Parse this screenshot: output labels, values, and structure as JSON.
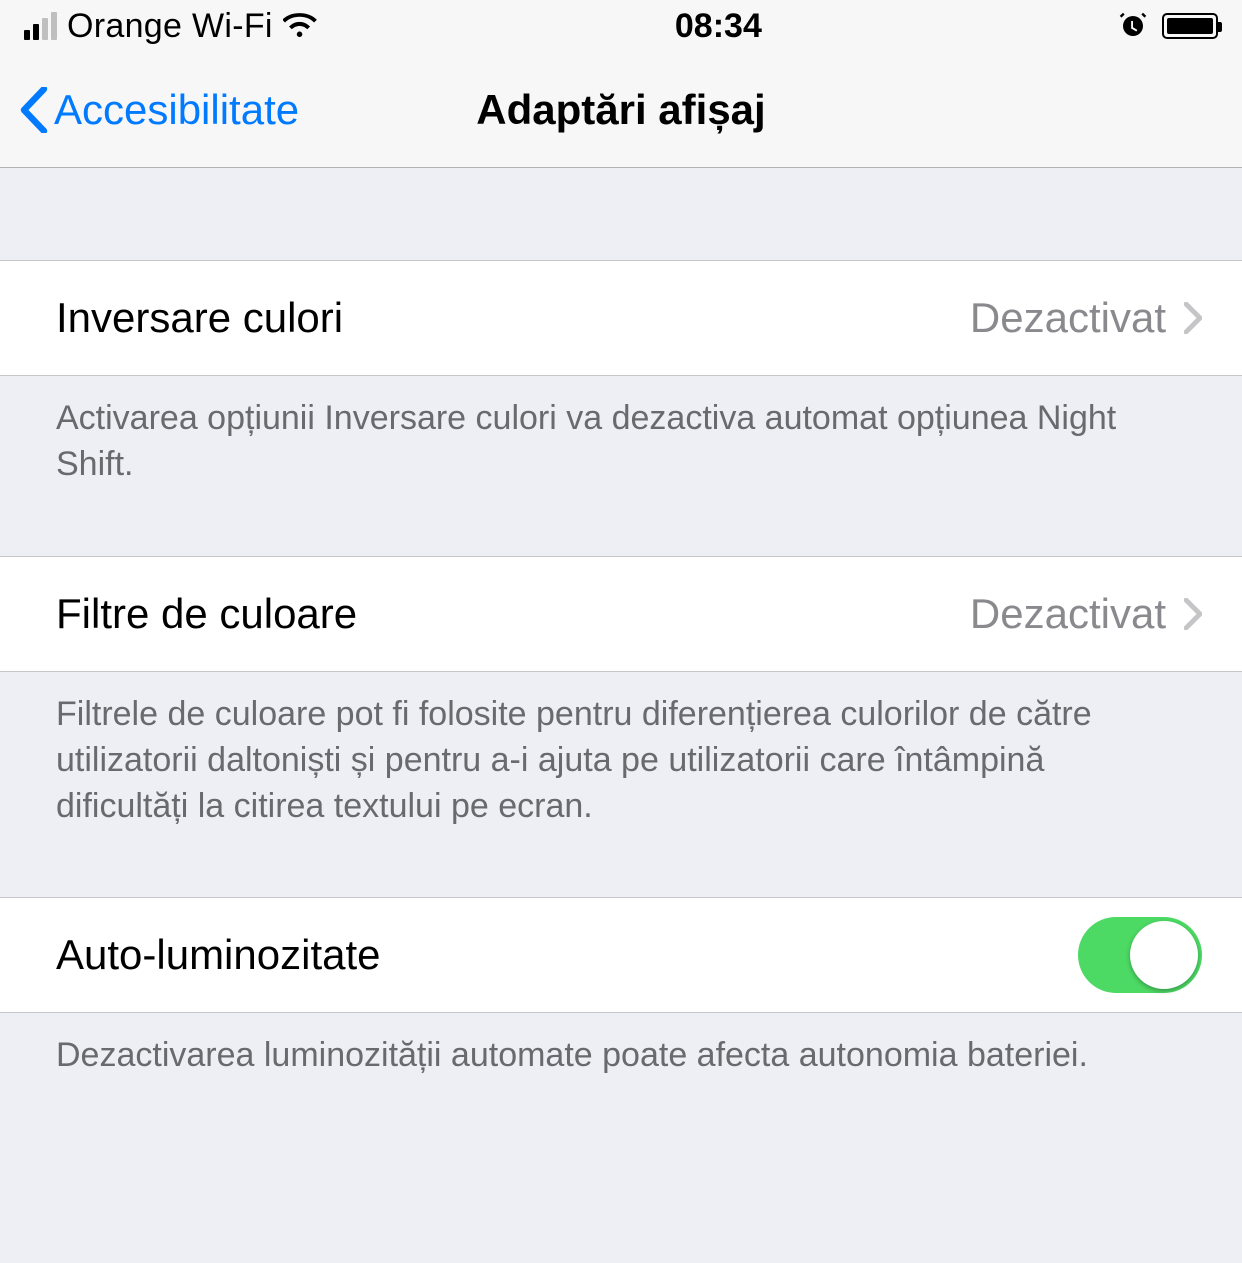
{
  "status_bar": {
    "carrier": "Orange Wi-Fi",
    "time": "08:34"
  },
  "nav": {
    "back_label": "Accesibilitate",
    "title": "Adaptări afișaj"
  },
  "rows": {
    "invert": {
      "label": "Inversare culori",
      "value": "Dezactivat",
      "footer": "Activarea opțiunii Inversare culori va dezactiva automat opțiunea Night Shift."
    },
    "filters": {
      "label": "Filtre de culoare",
      "value": "Dezactivat",
      "footer": "Filtrele de culoare pot fi folosite pentru diferențierea culorilor de către utilizatorii daltoniști și pentru a-i ajuta pe utilizatorii care întâmpină dificultăți la citirea textului pe ecran."
    },
    "auto_brightness": {
      "label": "Auto-luminozitate",
      "footer": "Dezactivarea luminozității automate poate afecta autonomia bateriei."
    }
  }
}
